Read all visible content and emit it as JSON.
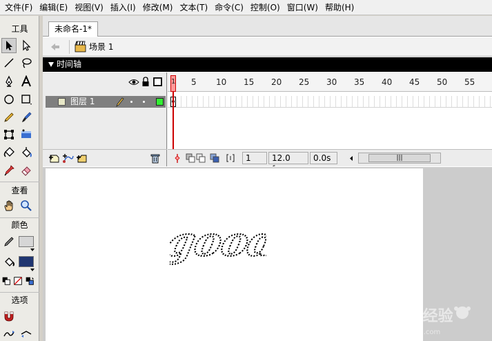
{
  "menu": [
    "文件(F)",
    "编辑(E)",
    "视图(V)",
    "插入(I)",
    "修改(M)",
    "文本(T)",
    "命令(C)",
    "控制(O)",
    "窗口(W)",
    "帮助(H)"
  ],
  "tools": {
    "section_tools": "工具",
    "section_view": "查看",
    "section_colors": "颜色",
    "section_options": "选项",
    "stroke_color": "#d6d6d6",
    "fill_color": "#1f3570"
  },
  "document": {
    "tab_title": "未命名-1*",
    "scene_label": "场景 1"
  },
  "timeline": {
    "title": "时间轴",
    "layer_name": "图层 1",
    "layer_color": "#33ee33",
    "frame_numbers": [
      "1",
      "5",
      "10",
      "15",
      "20",
      "25",
      "30",
      "35",
      "40",
      "45",
      "50",
      "55"
    ],
    "current_frame": "1",
    "fps": "12.0 fps",
    "elapsed": "0.0s"
  },
  "stage": {
    "text_content": "good"
  },
  "watermark": {
    "brand": "Baidu经验",
    "url": "jingyan.baidu.com"
  }
}
